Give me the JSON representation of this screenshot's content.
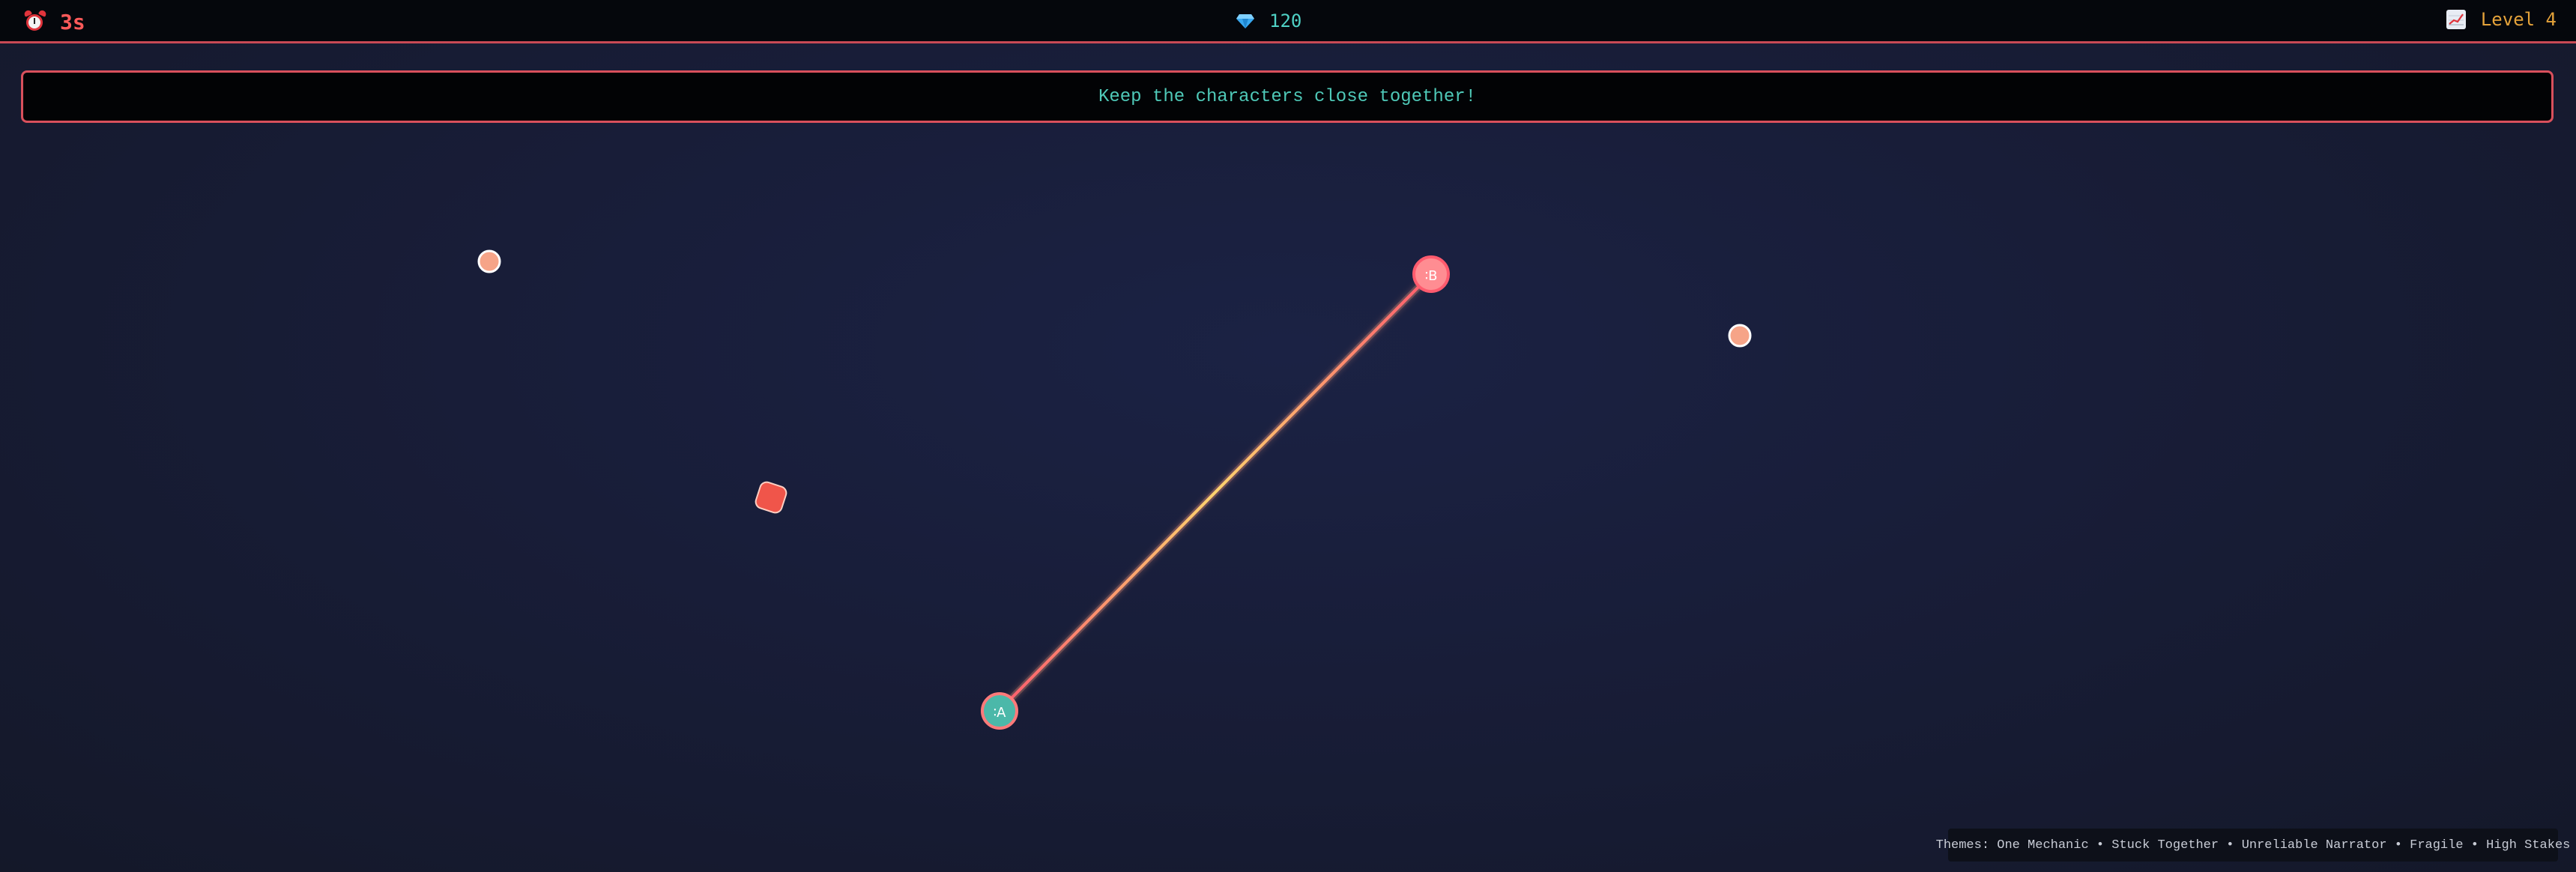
{
  "hud": {
    "timer": {
      "icon": "alarm-clock-icon",
      "value": "3s"
    },
    "score": {
      "icon": "gem-icon",
      "value": "120"
    },
    "level": {
      "icon": "chart-increasing-icon",
      "value": "Level 4"
    }
  },
  "message": "Keep the characters close together!",
  "characters": [
    {
      "name": "character-a",
      "glyph": "∶A",
      "color": "#4bb8a9"
    },
    {
      "name": "character-b",
      "glyph": "∶B",
      "color": "#ff8d92"
    }
  ],
  "themes": "Themes: One Mechanic • Stuck Together • Unreliable Narrator • Fragile • High Stakes",
  "colors": {
    "accent": "#d9505c",
    "timer": "#ff5a5a",
    "score": "#4fd1c5",
    "level": "#e4a23a",
    "tether_start": "#ff5b6e",
    "tether_mid": "#ffd36e",
    "hazard": "#f0554a",
    "orb": "#f6a488"
  }
}
